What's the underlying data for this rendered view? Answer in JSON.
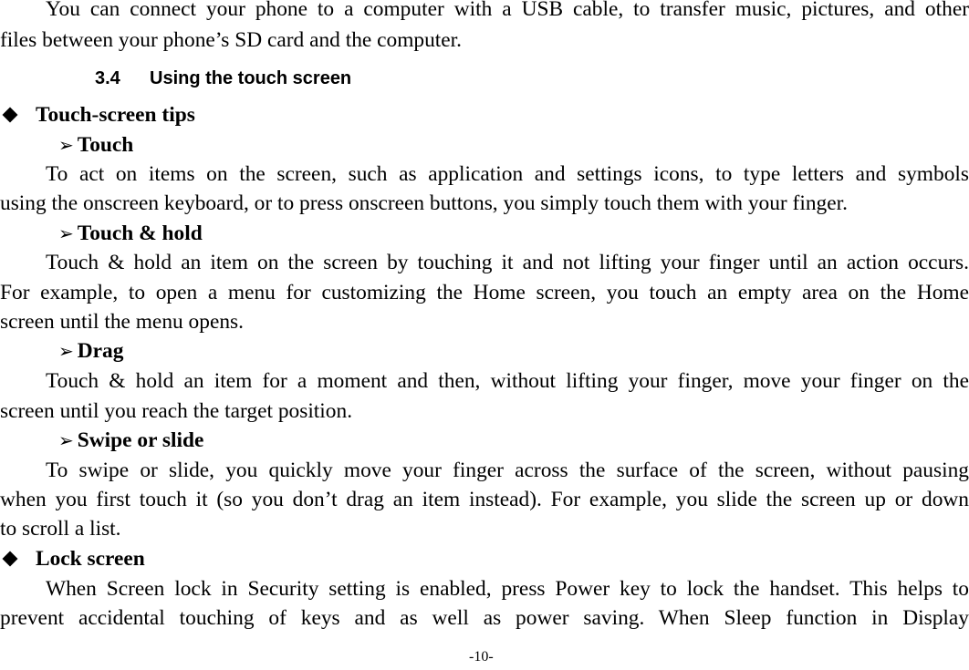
{
  "page": {
    "intro": {
      "line1": "You can connect your phone to a computer with a USB cable, to transfer music, pictures, and other",
      "line2": "files between your phone’s SD card and the computer."
    },
    "section": {
      "number": "3.4",
      "title": "Using the touch screen"
    },
    "bullets": [
      {
        "label": "Touch-screen tips",
        "icon": "diamond-bullet"
      },
      {
        "label": "Lock screen",
        "icon": "diamond-bullet"
      }
    ],
    "subsections": [
      {
        "label": "Touch",
        "icon": "arrowhead-bullet",
        "lines": [
          "To act on items on the screen, such as application and settings icons, to type letters and symbols",
          "using the onscreen keyboard, or to press onscreen buttons, you simply touch them with your finger."
        ]
      },
      {
        "label": "Touch & hold",
        "icon": "arrowhead-bullet",
        "lines": [
          "Touch & hold an item on the screen by touching it and not lifting your finger until an action occurs.",
          "For example, to open a menu for customizing the Home screen, you touch an empty area on the Home",
          "screen until the menu opens."
        ]
      },
      {
        "label": "Drag",
        "icon": "arrowhead-bullet",
        "lines": [
          "Touch & hold an item for a moment and then, without lifting your finger, move your finger on the",
          "screen until you reach the target position."
        ]
      },
      {
        "label": "Swipe or slide",
        "icon": "arrowhead-bullet",
        "lines": [
          "To swipe or slide, you quickly move your finger across the surface of the screen, without pausing",
          "when you first touch it (so you don’t drag an item instead). For example, you slide the screen up or down",
          "to scroll a list."
        ]
      }
    ],
    "lock_screen": {
      "lines": [
        "When Screen lock in Security setting is enabled, press Power key to lock the handset. This helps to",
        "prevent accidental touching of keys and as well as power saving.  When Sleep function in Display"
      ]
    },
    "page_number": "-10-"
  }
}
